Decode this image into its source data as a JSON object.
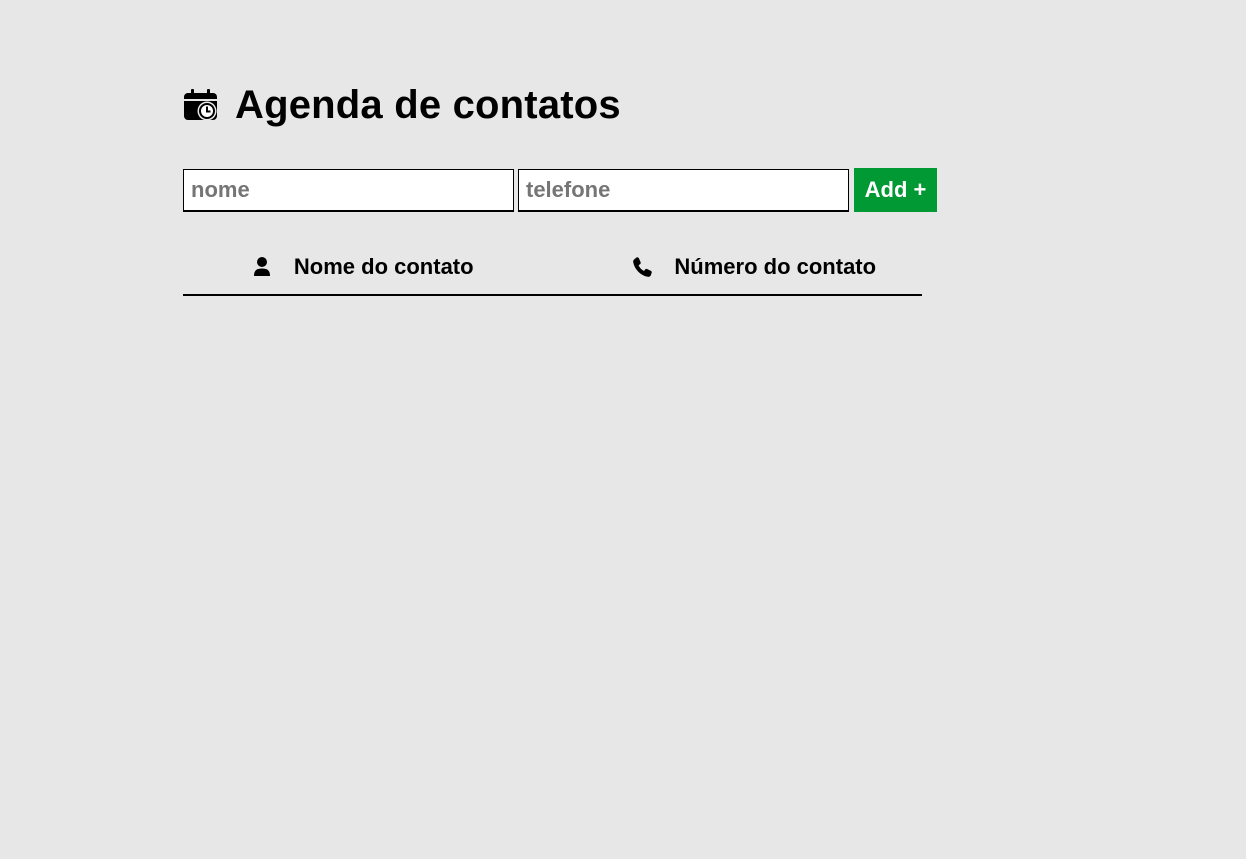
{
  "header": {
    "title": "Agenda de contatos",
    "icon": "calendar-clock-icon"
  },
  "form": {
    "name_placeholder": "nome",
    "phone_placeholder": "telefone",
    "add_label": "Add +",
    "add_color": "#009933"
  },
  "table": {
    "columns": [
      {
        "label": "Nome do contato",
        "icon": "user-icon"
      },
      {
        "label": "Número do contato",
        "icon": "phone-icon"
      }
    ],
    "rows": []
  },
  "colors": {
    "background": "#e7e7e7",
    "text": "#000000"
  }
}
